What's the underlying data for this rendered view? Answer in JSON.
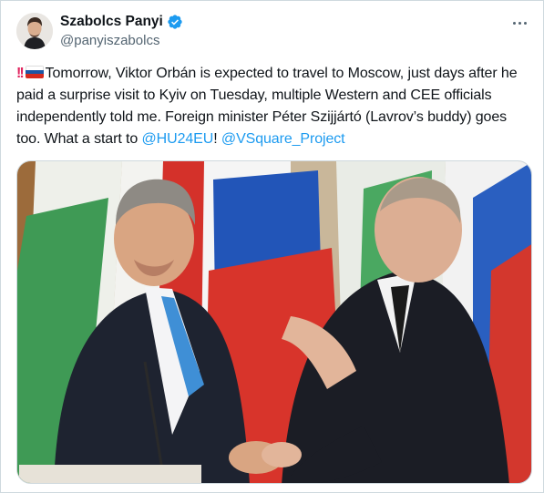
{
  "tweet": {
    "author": {
      "display_name": "Szabolcs Panyi",
      "handle": "@panyiszabolcs",
      "verified": true
    },
    "text_intro": "Tomorrow, Viktor Orbán is expected to travel to Moscow, just days after he paid a surprise visit to Kyiv on Tuesday, multiple Western and CEE officials independently told me. Foreign minister Péter Szijjártó (Lavrov’s buddy) goes too. What a start to ",
    "mention_1": "@HU24EU",
    "text_between": "! ",
    "mention_2": "@VSquare_Project",
    "emoji_prefix": [
      "double-exclamation",
      "russia-flag"
    ],
    "media": {
      "type": "photo",
      "description_icons": [
        "hungary-flag",
        "russia-flag"
      ]
    }
  },
  "colors": {
    "link": "#1d9bf0",
    "verified": "#1d9bf0",
    "text": "#0f1419",
    "secondary": "#536471",
    "border": "#cfd9de"
  }
}
